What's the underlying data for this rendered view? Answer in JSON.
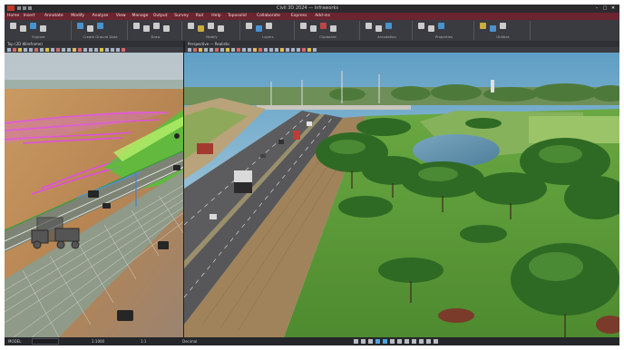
{
  "app": {
    "title": "Civil 3D 2024 — Infraworks",
    "icons": {
      "app": "app-logo-icon",
      "minimize": "minimize-icon",
      "maximize": "maximize-icon",
      "close": "close-icon"
    },
    "window_controls": {
      "minimize": "–",
      "maximize": "□",
      "close": "✕"
    }
  },
  "menu": {
    "items": [
      {
        "label": "Home"
      },
      {
        "label": "Insert"
      },
      {
        "label": "Annotate"
      },
      {
        "label": "Modify"
      },
      {
        "label": "Analyze"
      },
      {
        "label": "View"
      },
      {
        "label": "Manage"
      },
      {
        "label": "Output"
      },
      {
        "label": "Survey"
      },
      {
        "label": "Rail"
      },
      {
        "label": "Help"
      },
      {
        "label": "Toposolid"
      },
      {
        "label": "Collaborate"
      },
      {
        "label": "Express"
      },
      {
        "label": "Add-ins"
      }
    ]
  },
  "ribbon": {
    "groups": [
      {
        "label": "Explore"
      },
      {
        "label": "Create Ground Data"
      },
      {
        "label": "Draw"
      },
      {
        "label": "Modify"
      },
      {
        "label": "Layers"
      },
      {
        "label": "Clipboard"
      },
      {
        "label": "Annotation"
      },
      {
        "label": "Properties"
      },
      {
        "label": "Utilities"
      }
    ],
    "colors": {
      "blue": "#4aa3e8",
      "white": "#e6e6e6",
      "yellow": "#e2c23f",
      "red": "#d04a4a",
      "green": "#6fbf5a"
    }
  },
  "viewports": {
    "left": {
      "title": "Top (2D Wireframe)",
      "style": "wireframe"
    },
    "right": {
      "title": "Perspective — Realistic",
      "style": "realistic"
    }
  },
  "status": {
    "model": "MODEL",
    "coords": "1:1000",
    "scale": "1:1",
    "decimal": "Decimal",
    "icons": [
      "snap-icon",
      "grid-icon",
      "ortho-icon",
      "polar-icon",
      "osnap-icon",
      "otrack-icon",
      "lineweight-icon",
      "transparency-icon",
      "selection-icon",
      "annotation-icon",
      "workspace-icon",
      "settings-icon"
    ]
  }
}
